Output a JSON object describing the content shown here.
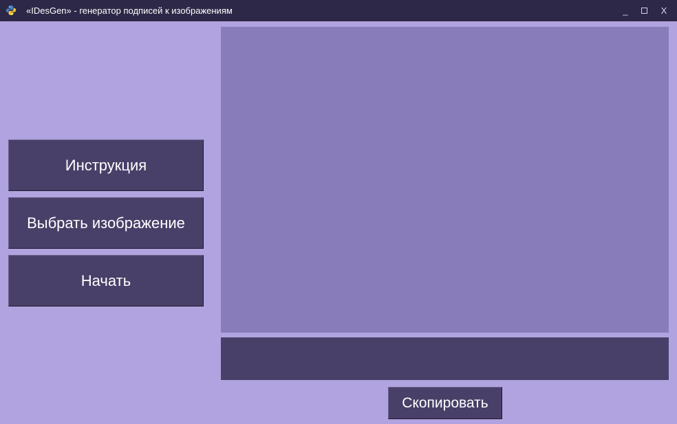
{
  "window": {
    "title": "«IDesGen» - генератор подписей к изображениям",
    "app_icon": "python-logo-icon",
    "controls": {
      "minimize": "_",
      "maximize_icon": "square-icon",
      "close": "X"
    }
  },
  "sidebar": {
    "buttons": [
      {
        "label": "Инструкция"
      },
      {
        "label": "Выбрать изображение"
      },
      {
        "label": "Начать"
      }
    ]
  },
  "main": {
    "caption_text": "",
    "copy_label": "Скопировать"
  },
  "colors": {
    "background": "#b0a3df",
    "titlebar": "#2d2847",
    "button": "#484068",
    "image_panel": "#887cba",
    "text": "#ffffff"
  }
}
